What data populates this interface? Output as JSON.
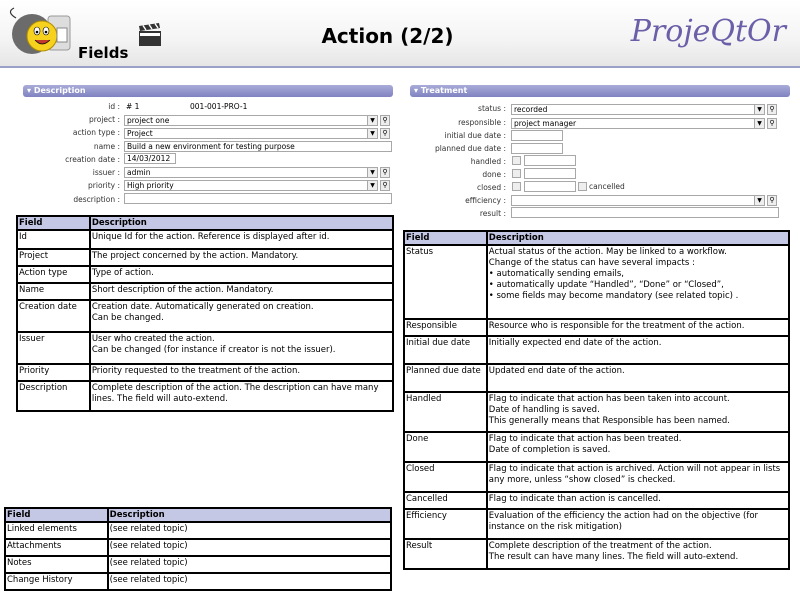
{
  "header": {
    "fields_label": "Fields",
    "title": "Action (2/2)",
    "brand": "ProjeQtOr"
  },
  "description_panel": {
    "title": "Description",
    "id_label": "id :",
    "id_value": "# 1",
    "id_reference": "001-001-PRO-1",
    "project_label": "project :",
    "project_value": "project one",
    "action_type_label": "action type :",
    "action_type_value": "Project",
    "name_label": "name :",
    "name_value": "Build a new environment for testing purpose",
    "creation_date_label": "creation date :",
    "creation_date_value": "14/03/2012",
    "issuer_label": "issuer :",
    "issuer_value": "admin",
    "priority_label": "priority :",
    "priority_value": "High priority",
    "description_label": "description :"
  },
  "treatment_panel": {
    "title": "Treatment",
    "status_label": "status :",
    "status_value": "recorded",
    "responsible_label": "responsible :",
    "responsible_value": "project manager",
    "initial_due_date_label": "initial due date :",
    "planned_due_date_label": "planned due date :",
    "handled_label": "handled :",
    "done_label": "done :",
    "closed_label": "closed :",
    "cancelled_label": "cancelled",
    "efficiency_label": "efficiency :",
    "result_label": "result :"
  },
  "table1": {
    "headers": [
      "Field",
      "Description"
    ],
    "rows": [
      {
        "field": "Id",
        "desc": [
          "Unique Id for the action. Reference is displayed after id."
        ]
      },
      {
        "field": "Project",
        "desc": [
          "The project concerned by the action. Mandatory."
        ]
      },
      {
        "field": "Action type",
        "desc": [
          "Type of action."
        ]
      },
      {
        "field": "Name",
        "desc": [
          "Short description of the action. Mandatory."
        ]
      },
      {
        "field": "Creation date",
        "desc": [
          "Creation date. Automatically generated on creation.",
          "Can be changed."
        ]
      },
      {
        "field": "Issuer",
        "desc": [
          "User who created the action.",
          "Can be changed (for instance if creator is not the issuer)."
        ]
      },
      {
        "field": "Priority",
        "desc": [
          "Priority requested to the treatment of the action."
        ]
      },
      {
        "field": "Description",
        "desc": [
          "Complete description of the action. The description can have many lines. The field will auto-extend."
        ]
      }
    ]
  },
  "table2": {
    "headers": [
      "Field",
      "Description"
    ],
    "rows": [
      {
        "field": "Status",
        "desc": [
          "Actual status of the action. May be linked to a workflow.",
          "Change of the status can have several impacts :",
          "• automatically sending emails,",
          "• automatically update “Handled”, “Done” or “Closed”,",
          "• some fields may become mandatory (see related topic) ."
        ]
      },
      {
        "field": "Responsible",
        "desc": [
          "Resource who is responsible for the treatment of the action."
        ]
      },
      {
        "field": "Initial due date",
        "desc": [
          "Initially expected end date of the action."
        ]
      },
      {
        "field": "Planned due date",
        "desc": [
          "Updated end date of the action."
        ]
      },
      {
        "field": "Handled",
        "desc": [
          "Flag to indicate that action has been taken into account.",
          "Date of handling is saved.",
          "This generally means that Responsible has been named."
        ]
      },
      {
        "field": "Done",
        "desc": [
          "Flag to indicate that action has been treated.",
          "Date of completion is saved."
        ]
      },
      {
        "field": "Closed",
        "desc": [
          "Flag to indicate that action is archived. Action will not appear in lists any more, unless “show closed” is checked."
        ]
      },
      {
        "field": "Cancelled",
        "desc": [
          "Flag to indicate than action is cancelled."
        ]
      },
      {
        "field": "Efficiency",
        "desc": [
          "Evaluation of the efficiency the action had on the objective (for instance on the risk mitigation)"
        ]
      },
      {
        "field": "Result",
        "desc": [
          "Complete description of the treatment of the action.",
          "The result can have many lines. The field will auto-extend."
        ]
      }
    ]
  },
  "table3": {
    "headers": [
      "Field",
      "Description"
    ],
    "rows": [
      {
        "field": "Linked elements",
        "desc": [
          "(see related topic)"
        ]
      },
      {
        "field": "Attachments",
        "desc": [
          "(see related topic)"
        ]
      },
      {
        "field": "Notes",
        "desc": [
          "(see related topic)"
        ]
      },
      {
        "field": "Change History",
        "desc": [
          "(see related topic)"
        ]
      }
    ]
  }
}
